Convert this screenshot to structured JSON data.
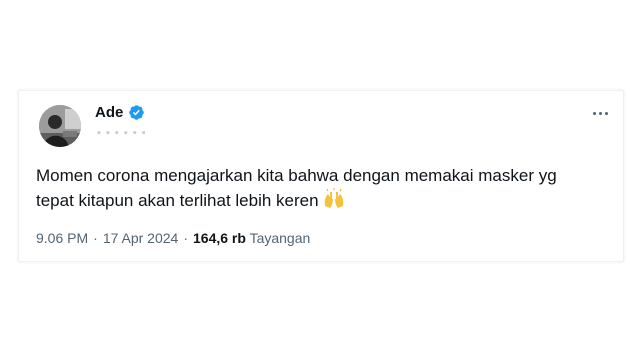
{
  "tweet": {
    "author": {
      "display_name": "Ade",
      "verified": true,
      "avatar_icon": "profile-photo-icon"
    },
    "text_line1": "Momen corona mengajarkan kita bahwa dengan memakai masker yg",
    "text_line2": "tepat kitapun akan terlihat lebih keren",
    "emoji": "raising-hands-emoji-icon",
    "time": "9.06 PM",
    "separator": "·",
    "date": "17 Apr 2024",
    "views_count": "164,6 rb",
    "views_label": "Tayangan",
    "more_icon": "more-options-icon"
  },
  "colors": {
    "verified_blue": "#1d9bf0",
    "text_primary": "#0f1419",
    "text_secondary": "#536471"
  }
}
